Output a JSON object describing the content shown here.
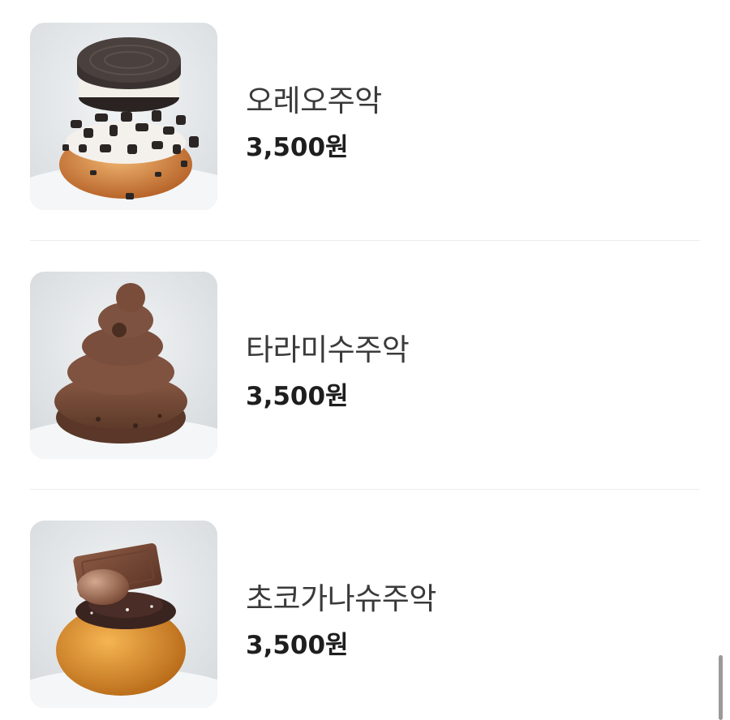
{
  "menu": {
    "items": [
      {
        "name": "오레오주악",
        "price": "3,500원",
        "image_icon": "oreo-juak-photo"
      },
      {
        "name": "타라미수주악",
        "price": "3,500원",
        "image_icon": "tiramisu-juak-photo"
      },
      {
        "name": "초코가나슈주악",
        "price": "3,500원",
        "image_icon": "choco-ganache-juak-photo"
      }
    ]
  },
  "colors": {
    "background": "#ffffff",
    "name_text": "#3a3a3a",
    "price_text": "#1e1e1e",
    "divider": "#ececec",
    "scrollbar": "#9a9a9a"
  }
}
